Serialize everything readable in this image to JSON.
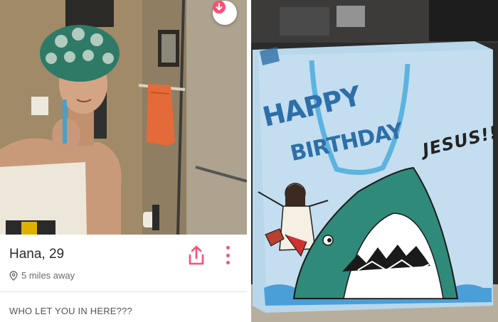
{
  "profile": {
    "name_age": "Hana, 29",
    "distance": "5 miles away",
    "bio": "WHO LET YOU IN HERE???",
    "icons": {
      "dislike": "arrow-down-icon",
      "share": "share-icon",
      "more": "more-vertical-icon",
      "location": "location-pin-icon"
    },
    "colors": {
      "accent": "#fd4e74"
    }
  },
  "gift_bag": {
    "line1": "HAPPY",
    "line2": "BIRTHDAY",
    "handwritten": "JESUS!!"
  }
}
